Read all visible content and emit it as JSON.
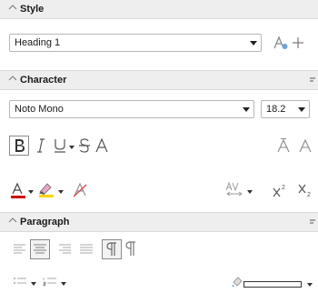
{
  "sections": {
    "style": {
      "title": "Style"
    },
    "character": {
      "title": "Character"
    },
    "paragraph": {
      "title": "Paragraph"
    }
  },
  "style": {
    "paragraph_style": "Heading 1"
  },
  "character": {
    "font_name": "Noto Mono",
    "font_size": "18.2"
  },
  "colors": {
    "font_color": "#cc0000",
    "highlight": "#ffd200",
    "border_color": "#ffffff"
  }
}
